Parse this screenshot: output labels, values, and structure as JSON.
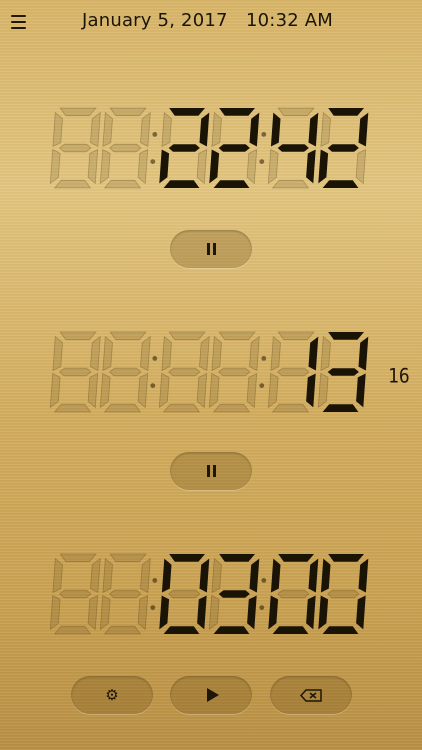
{
  "header": {
    "date": "January 5, 2017",
    "time": "10:32 AM",
    "menu_icon": "hamburger-menu-icon"
  },
  "clocks": [
    {
      "id": "clock-1",
      "digits": "002242",
      "lit_from": 2,
      "sub": ""
    },
    {
      "id": "stopwatch",
      "digits": "000013",
      "lit_from": 4,
      "sub": "16"
    },
    {
      "id": "timer",
      "digits": "000300",
      "lit_from": 2,
      "sub": ""
    }
  ],
  "buttons": {
    "pause_icon": "pause-icon",
    "settings_icon": "gear-icon",
    "play_icon": "play-icon",
    "delete_icon": "backspace-icon"
  },
  "colors": {
    "lit": "#1a1407",
    "dim": "rgba(60,40,10,0.14)",
    "gold": "#d8b567"
  }
}
